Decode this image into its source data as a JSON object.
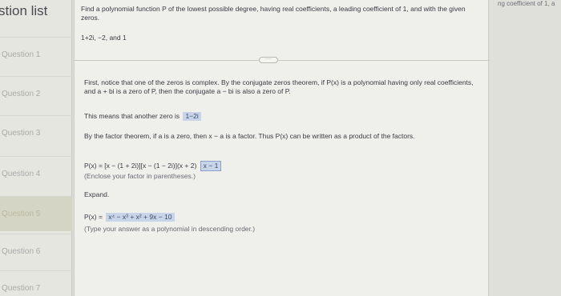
{
  "sidebar": {
    "title": "stion list",
    "items": [
      "Question 1",
      "Question 2",
      "Question 3",
      "Question 4",
      "Question 5",
      "Question 6",
      "Question 7"
    ],
    "active_index": 4
  },
  "right_panel": {
    "text": "ng coefficient of 1, a"
  },
  "question": {
    "prompt": "Find a polynomial function P of the lowest possible degree, having real coefficients, a leading coefficient of 1, and with the given zeros.",
    "zeros": "1+2i, −2, and 1"
  },
  "more_button": "····",
  "explanation": {
    "p1": "First, notice that one of the zeros is complex. By the conjugate zeros theorem, if P(x) is a polynomial having only real coefficients, and a + bi is a zero of P, then the conjugate a − bi is also a zero of P.",
    "p2_text": "This means that another zero is",
    "p2_answer": "1−2i",
    "p3": "By the factor theorem, if a is a zero, then x − a is a factor. Thus P(x) can be written as a product of the factors.",
    "factored_prefix": "P(x) = [x − (1 + 2i)][x − (1 − 2i)](x + 2)",
    "factored_answer": "x − 1",
    "hint1": "(Enclose your factor in parentheses.)",
    "expand_label": "Expand.",
    "expanded_prefix": "P(x) =",
    "expanded_answer": "x⁴ − x³ + x² + 9x − 10",
    "hint2": "(Type your answer as a polynomial in descending order.)"
  }
}
